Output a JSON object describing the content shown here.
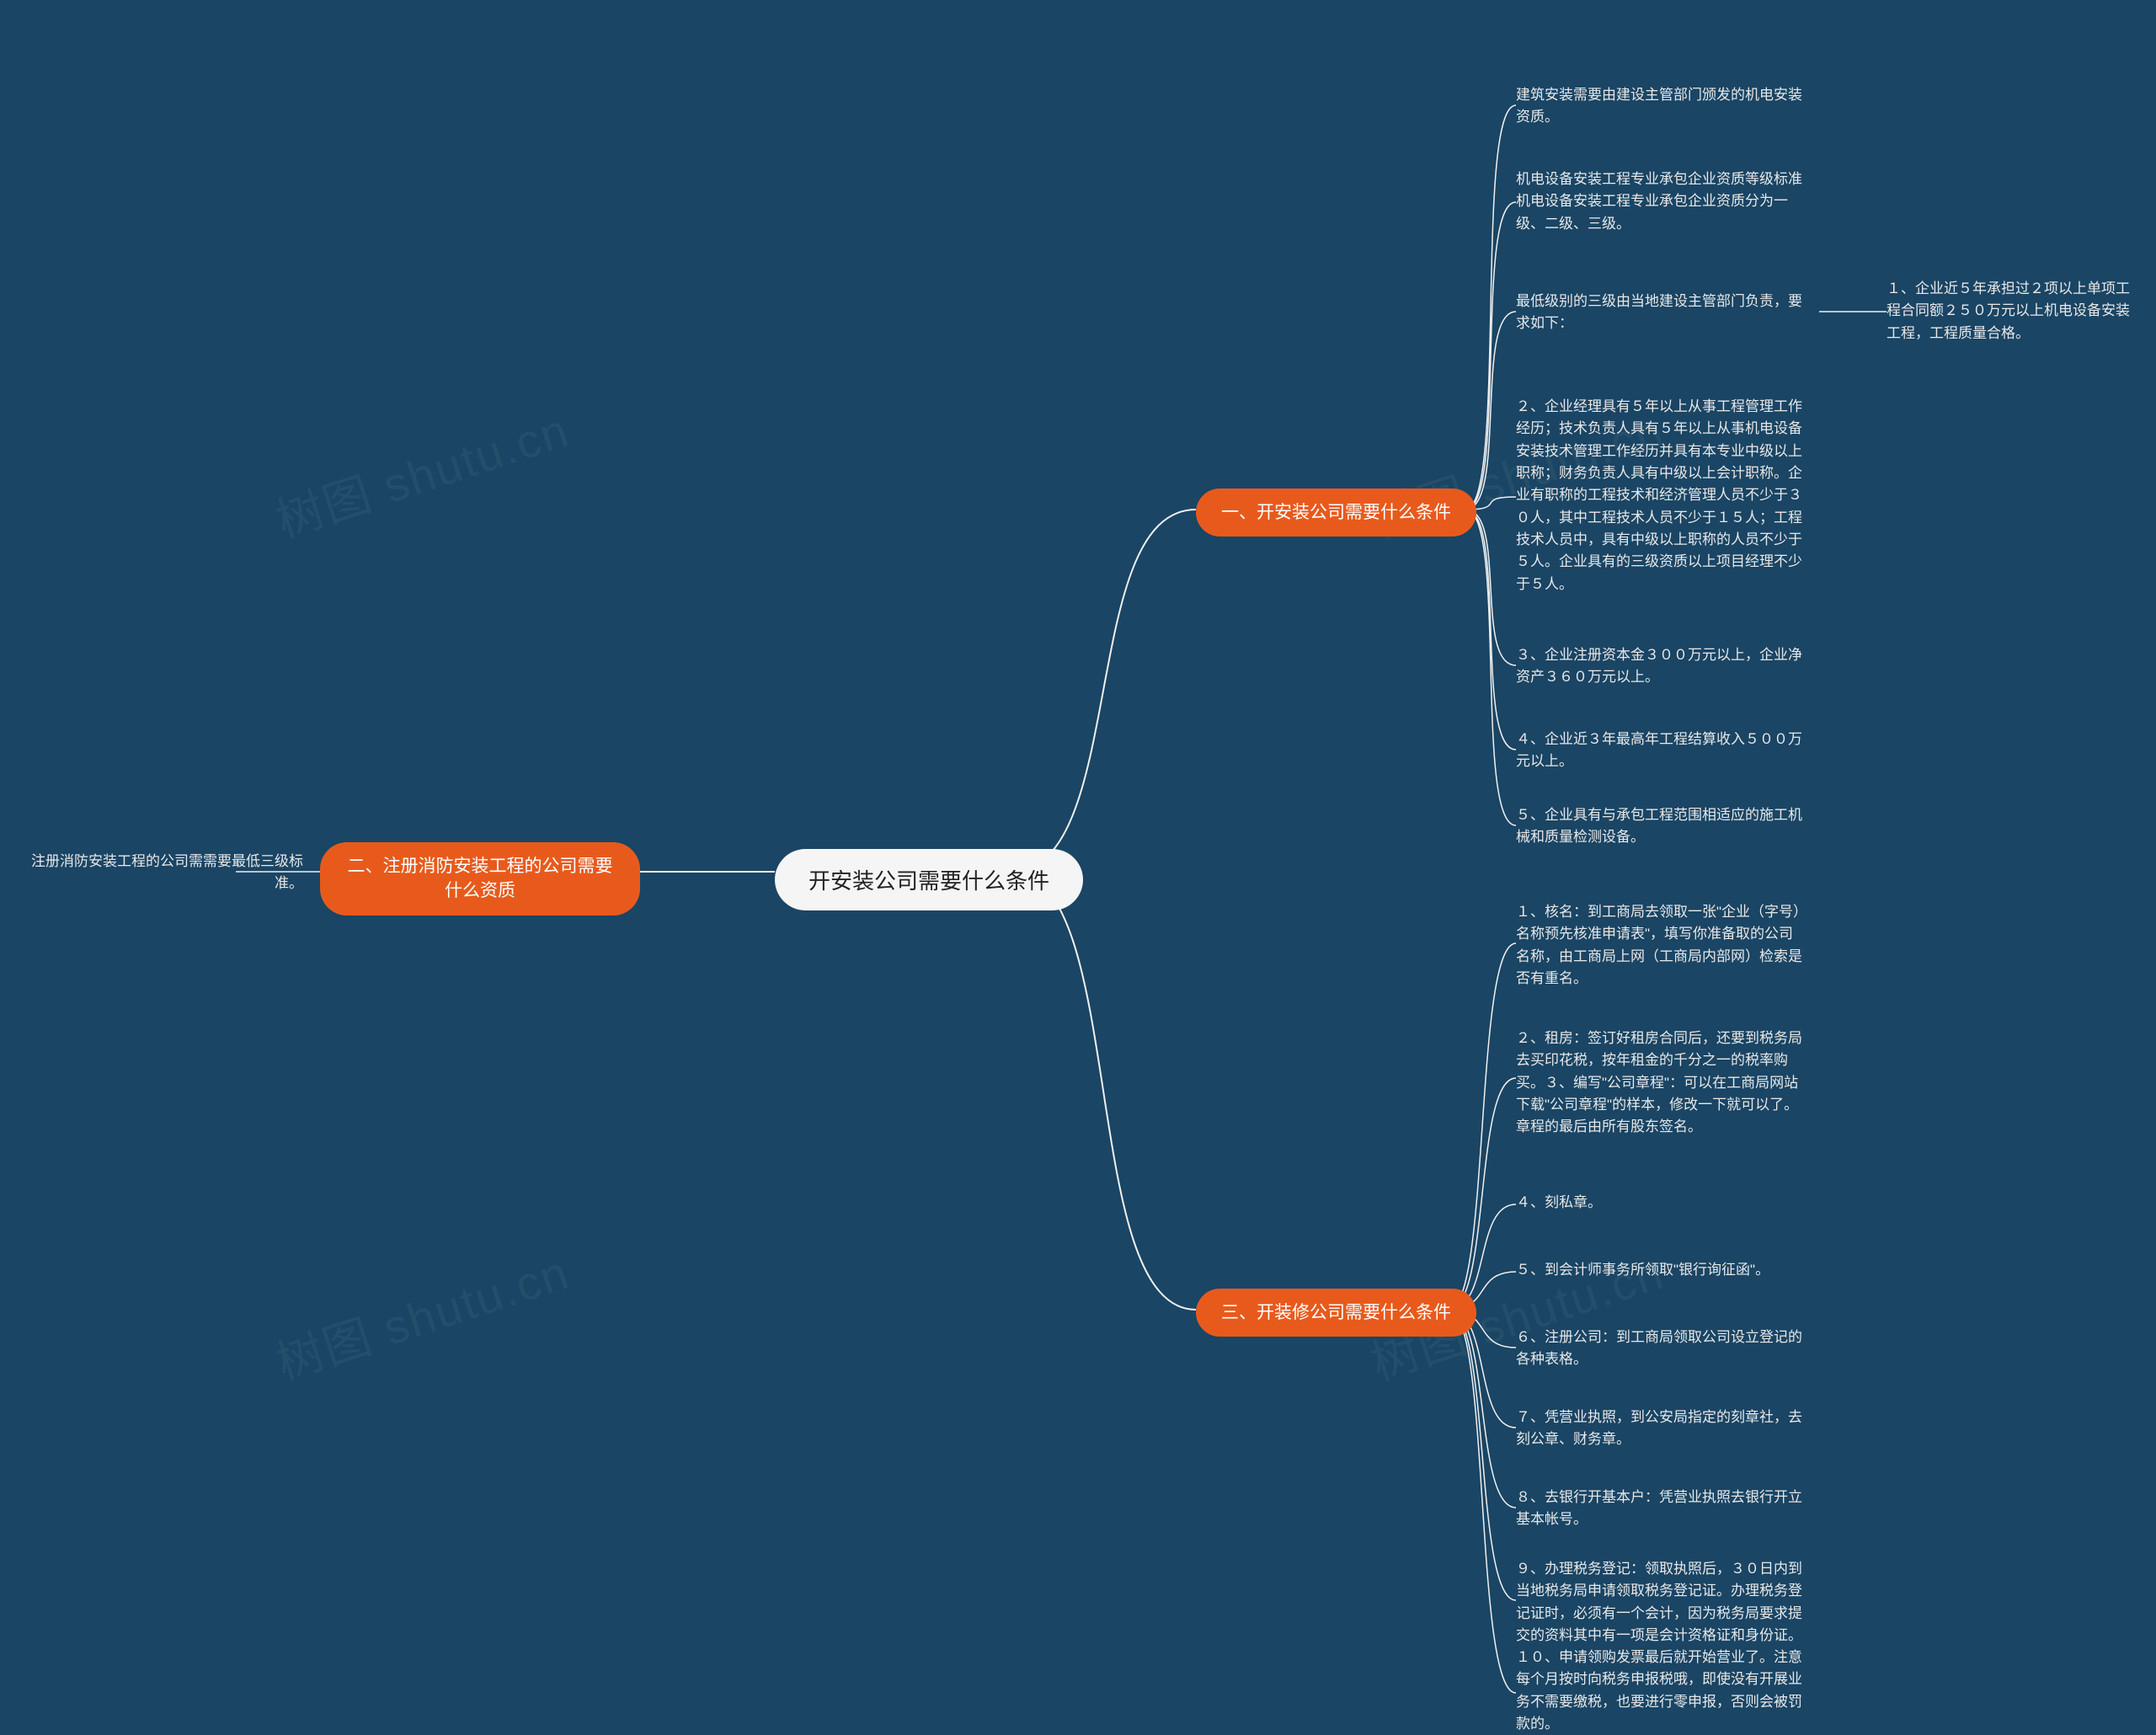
{
  "watermark": "树图 shutu.cn",
  "root": {
    "label": "开安装公司需要什么条件"
  },
  "branches": {
    "b1": {
      "label": "一、开安装公司需要什么条件"
    },
    "b2": {
      "label": "二、注册消防安装工程的公司需要什么资质"
    },
    "b3": {
      "label": "三、开装修公司需要什么条件"
    }
  },
  "leaves": {
    "b1_1": "建筑安装需要由建设主管部门颁发的机电安装资质。",
    "b1_2": "机电设备安装工程专业承包企业资质等级标准机电设备安装工程专业承包企业资质分为一级、二级、三级。",
    "b1_3": "最低级别的三级由当地建设主管部门负责，要求如下：",
    "b1_3_1": "１、企业近５年承担过２项以上单项工程合同额２５０万元以上机电设备安装工程，工程质量合格。",
    "b1_4": "２、企业经理具有５年以上从事工程管理工作经历；技术负责人具有５年以上从事机电设备安装技术管理工作经历并具有本专业中级以上职称；财务负责人具有中级以上会计职称。企业有职称的工程技术和经济管理人员不少于３０人，其中工程技术人员不少于１５人；工程技术人员中，具有中级以上职称的人员不少于５人。企业具有的三级资质以上项目经理不少于５人。",
    "b1_5": "３、企业注册资本金３００万元以上，企业净资产３６０万元以上。",
    "b1_6": "４、企业近３年最高年工程结算收入５００万元以上。",
    "b1_7": "５、企业具有与承包工程范围相适应的施工机械和质量检测设备。",
    "b2_1": "注册消防安装工程的公司需需要最低三级标准。",
    "b3_1": "１、核名：到工商局去领取一张\"企业（字号）名称预先核准申请表\"，填写你准备取的公司名称，由工商局上网（工商局内部网）检索是否有重名。",
    "b3_2": "２、租房：签订好租房合同后，还要到税务局去买印花税，按年租金的千分之一的税率购买。３、编写\"公司章程\"：可以在工商局网站下载\"公司章程\"的样本，修改一下就可以了。章程的最后由所有股东签名。",
    "b3_3": "４、刻私章。",
    "b3_4": "５、到会计师事务所领取\"银行询征函\"。",
    "b3_5": "６、注册公司：到工商局领取公司设立登记的各种表格。",
    "b3_6": "７、凭营业执照，到公安局指定的刻章社，去刻公章、财务章。",
    "b3_7": "８、去银行开基本户：凭营业执照去银行开立基本帐号。",
    "b3_8": "９、办理税务登记：领取执照后，３０日内到当地税务局申请领取税务登记证。办理税务登记证时，必须有一个会计，因为税务局要求提交的资料其中有一项是会计资格证和身份证。",
    "b3_9": "１０、申请领购发票最后就开始营业了。注意每个月按时向税务申报税哦，即使没有开展业务不需要缴税，也要进行零申报，否则会被罚款的。"
  }
}
